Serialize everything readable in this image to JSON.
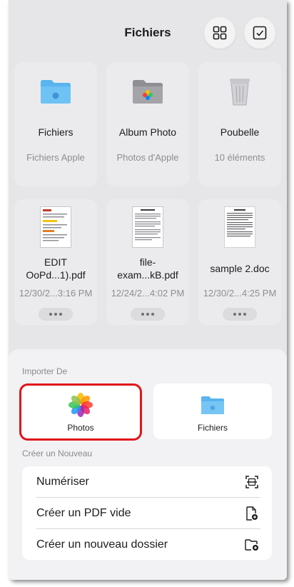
{
  "header": {
    "title": "Fichiers"
  },
  "toolbar": {
    "grid_icon": "grid-icon",
    "select_icon": "checkmark-square-icon"
  },
  "items": [
    {
      "name": "Fichiers",
      "sub": "Fichiers Apple",
      "icon": "folder-apple-icon"
    },
    {
      "name": "Album Photo",
      "sub": "Photos d'Apple",
      "icon": "folder-photos-icon"
    },
    {
      "name": "Poubelle",
      "sub": "10 éléments",
      "icon": "trash-icon"
    },
    {
      "name_line1": "EDIT",
      "name_line2": "OoPd...1).pdf",
      "sub": "12/30/2...3:16 PM",
      "icon": "pdf-thumbnail"
    },
    {
      "name_line1": "file-",
      "name_line2": "exam...kB.pdf",
      "sub": "12/24/2...4:02 PM",
      "icon": "pdf-thumbnail"
    },
    {
      "name_line1": "sample 2.doc",
      "sub": "12/30/2...4:25 PM",
      "icon": "doc-thumbnail"
    }
  ],
  "sheet": {
    "import_label": "Importer De",
    "import_options": [
      {
        "label": "Photos",
        "icon": "photos-app-icon",
        "highlighted": true
      },
      {
        "label": "Fichiers",
        "icon": "folder-icon"
      }
    ],
    "create_label": "Créer un Nouveau",
    "create_options": [
      {
        "label": "Numériser",
        "icon": "scan-document-icon"
      },
      {
        "label": "Créer un PDF vide",
        "icon": "new-document-icon"
      },
      {
        "label": "Créer un nouveau dossier",
        "icon": "new-folder-icon"
      }
    ]
  },
  "colors": {
    "accent_folder": "#5ab4ee",
    "highlight": "#e0141a",
    "background": "#e6e6e8"
  }
}
